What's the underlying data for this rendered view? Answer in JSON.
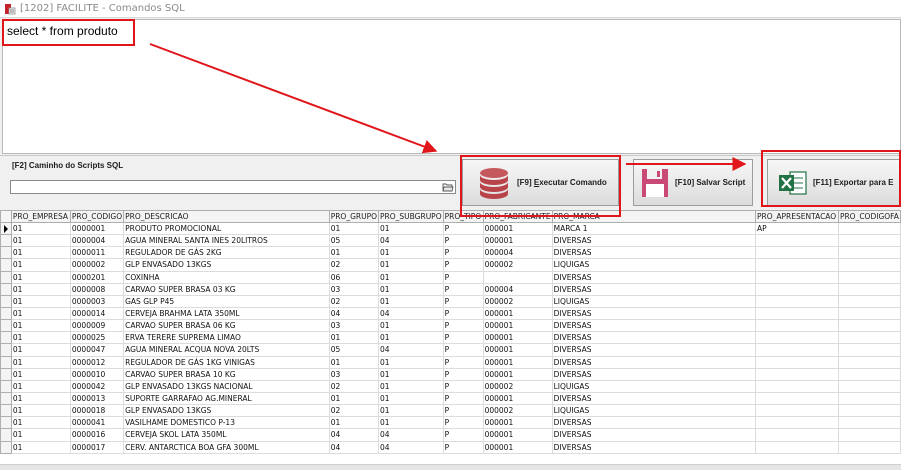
{
  "window": {
    "title": "[1202] FACILITE - Comandos SQL"
  },
  "editor": {
    "sql": "select * from produto"
  },
  "scripts": {
    "label": "[F2] Caminho do Scripts SQL",
    "path": ""
  },
  "buttons": {
    "execute": {
      "key": "[F9] ",
      "underlined": "E",
      "rest": "xecutar Comando"
    },
    "save": {
      "label": "[F10] Salvar Script"
    },
    "export": {
      "label": "[F11] Exportar para E"
    }
  },
  "colors": {
    "annotation": "#e0161b",
    "db_icon": "#b8444a",
    "excel": "#217346"
  },
  "grid": {
    "columns": [
      "PRO_EMPRESA",
      "PRO_CODIGO",
      "PRO_DESCRICAO",
      "PRO_GRUPO",
      "PRO_SUBGRUPO",
      "PRO_TIPO",
      "PRO_FABRICANTE",
      "PRO_MARCA",
      "PRO_APRESENTACAO",
      "PRO_CODIGOFA"
    ],
    "rows": [
      [
        "01",
        "0000001",
        "PRODUTO PROMOCIONAL",
        "01",
        "01",
        "P",
        "000001",
        "MARCA 1",
        "AP",
        ""
      ],
      [
        "01",
        "0000004",
        "AGUA MINERAL SANTA INES 20LITROS",
        "05",
        "04",
        "P",
        "000001",
        "DIVERSAS",
        "",
        ""
      ],
      [
        "01",
        "0000011",
        "REGULADOR DE GÁS 2KG",
        "01",
        "01",
        "P",
        "000004",
        "DIVERSAS",
        "",
        ""
      ],
      [
        "01",
        "0000002",
        "GLP ENVASADO 13KGS",
        "02",
        "01",
        "P",
        "000002",
        "LIQUIGAS",
        "",
        ""
      ],
      [
        "01",
        "0000201",
        "COXINHA",
        "06",
        "01",
        "P",
        "",
        "DIVERSAS",
        "",
        ""
      ],
      [
        "01",
        "0000008",
        "CARVAO SUPER BRASA 03 KG",
        "03",
        "01",
        "P",
        "000004",
        "DIVERSAS",
        "",
        ""
      ],
      [
        "01",
        "0000003",
        "GAS GLP P45",
        "02",
        "01",
        "P",
        "000002",
        "LIQUIGAS",
        "",
        ""
      ],
      [
        "01",
        "0000014",
        "CERVEJA BRAHMA LATA 350ML",
        "04",
        "04",
        "P",
        "000001",
        "DIVERSAS",
        "",
        ""
      ],
      [
        "01",
        "0000009",
        "CARVAO SUPER BRASA 06 KG",
        "03",
        "01",
        "P",
        "000001",
        "DIVERSAS",
        "",
        ""
      ],
      [
        "01",
        "0000025",
        "ERVA TERERE SUPREMA LIMAO",
        "01",
        "01",
        "P",
        "000001",
        "DIVERSAS",
        "",
        ""
      ],
      [
        "01",
        "0000047",
        "AGUA MINERAL ACQUA NOVA 20LTS",
        "05",
        "04",
        "P",
        "000001",
        "DIVERSAS",
        "",
        ""
      ],
      [
        "01",
        "0000012",
        "REGULADOR DE GÁS 1KG VINIGAS",
        "01",
        "01",
        "P",
        "000001",
        "DIVERSAS",
        "",
        ""
      ],
      [
        "01",
        "0000010",
        "CARVAO SUPER BRASA 10 KG",
        "03",
        "01",
        "P",
        "000001",
        "DIVERSAS",
        "",
        ""
      ],
      [
        "01",
        "0000042",
        "GLP ENVASADO 13KGS NACIONAL",
        "02",
        "01",
        "P",
        "000002",
        "LIQUIGAS",
        "",
        ""
      ],
      [
        "01",
        "0000013",
        "SUPORTE GARRAFAO AG.MINERAL",
        "01",
        "01",
        "P",
        "000001",
        "DIVERSAS",
        "",
        ""
      ],
      [
        "01",
        "0000018",
        "GLP ENVASADO 13KGS",
        "02",
        "01",
        "P",
        "000002",
        "LIQUIGAS",
        "",
        ""
      ],
      [
        "01",
        "0000041",
        "VASILHAME DOMESTICO P-13",
        "01",
        "01",
        "P",
        "000001",
        "DIVERSAS",
        "",
        ""
      ],
      [
        "01",
        "0000016",
        "CERVEJA SKOL LATA 350ML",
        "04",
        "04",
        "P",
        "000001",
        "DIVERSAS",
        "",
        ""
      ],
      [
        "01",
        "0000017",
        "CERV. ANTARCTICA BOA GFA 300ML",
        "04",
        "04",
        "P",
        "000001",
        "DIVERSAS",
        "",
        ""
      ]
    ]
  }
}
